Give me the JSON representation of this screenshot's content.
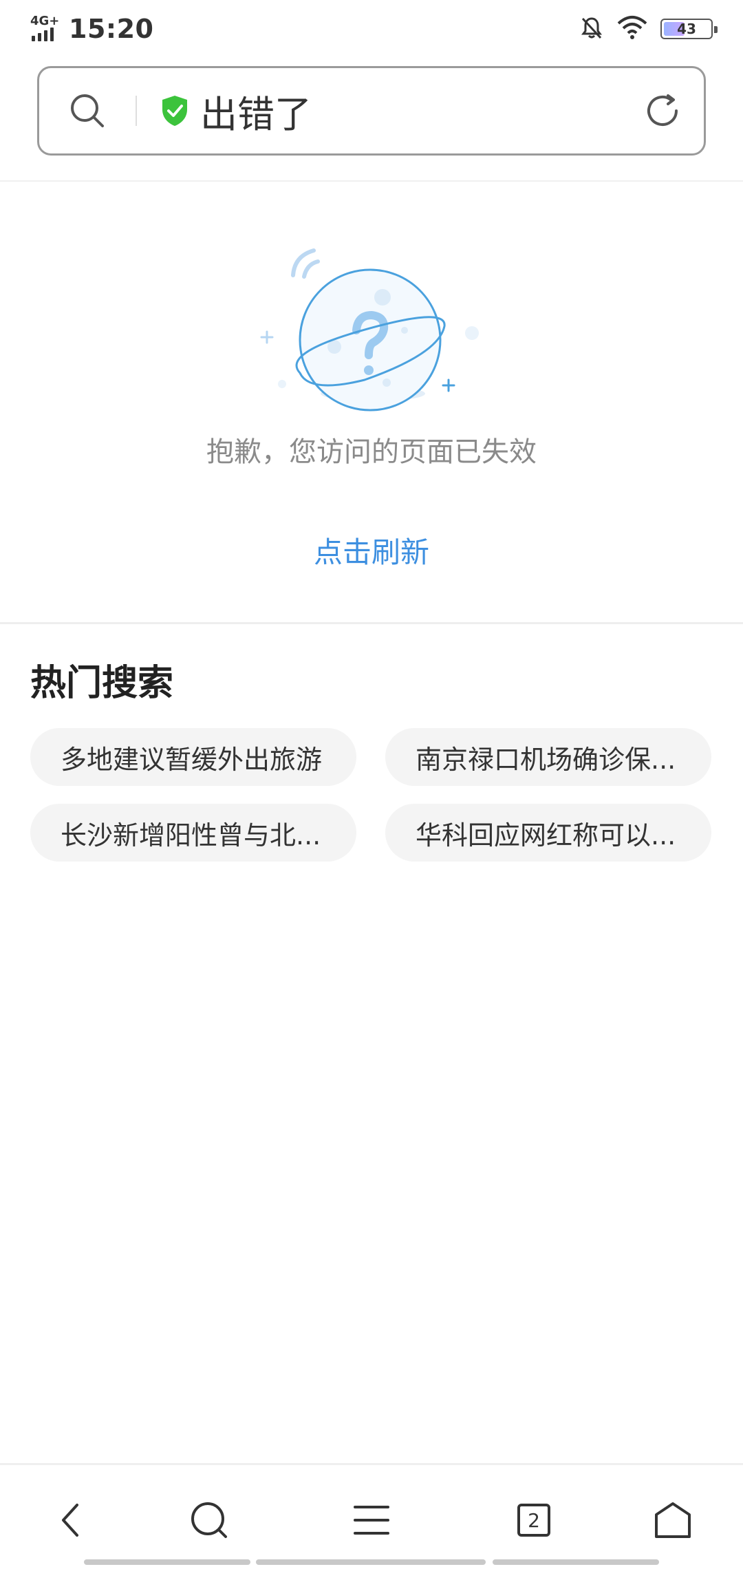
{
  "status_bar": {
    "network": "4G+",
    "time": "15:20",
    "battery_level": "43",
    "icons": [
      "signal-icon",
      "mute-bell-icon",
      "wifi-icon",
      "battery-icon"
    ]
  },
  "address_bar": {
    "title": "出错了",
    "icons": [
      "search-icon",
      "secure-shield-icon",
      "refresh-icon"
    ],
    "shield_color": "#3cc33c"
  },
  "error": {
    "message": "抱歉，您访问的页面已失效",
    "refresh_label": "点击刷新",
    "link_color": "#3d8fe0"
  },
  "hot_search": {
    "title": "热门搜索",
    "items": [
      "多地建议暂缓外出旅游",
      "南京禄口机场确诊保...",
      "长沙新增阳性曾与北...",
      "华科回应网红称可以..."
    ]
  },
  "bottom_nav": {
    "tab_count": "2",
    "icons": [
      "back-icon",
      "search-icon",
      "menu-icon",
      "tabs-icon",
      "home-icon"
    ]
  }
}
